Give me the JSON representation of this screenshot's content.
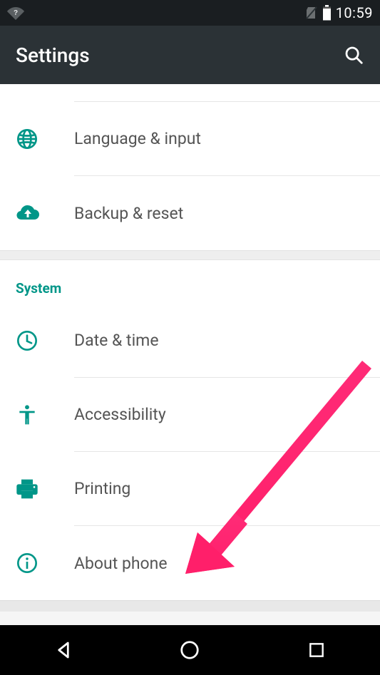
{
  "statusbar": {
    "time": "10:59"
  },
  "appbar": {
    "title": "Settings"
  },
  "section1": {
    "items": [
      {
        "label": "Language & input"
      },
      {
        "label": "Backup & reset"
      }
    ]
  },
  "section2": {
    "header": "System",
    "items": [
      {
        "label": "Date & time"
      },
      {
        "label": "Accessibility"
      },
      {
        "label": "Printing"
      },
      {
        "label": "About phone"
      }
    ]
  },
  "annotation": {
    "arrow_target": "About phone"
  }
}
